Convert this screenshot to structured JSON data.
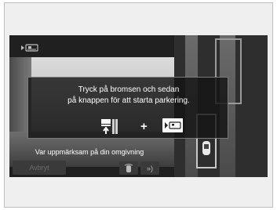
{
  "dialog": {
    "line1": "Tryck på bromsen och sedan",
    "line2": "på knappen för att starta parkering.",
    "plus": "+",
    "icons": [
      "brake-pedal-icon",
      "parking-button-icon"
    ]
  },
  "status": {
    "warning": "Var uppmärksam på din omgivning",
    "cancel_label": "Avbryt",
    "settings_label": "»)"
  },
  "icons": {
    "top_left": "parking-camera-icon",
    "bottom": [
      "car-sensor-icon",
      "sensor-waves-icon"
    ]
  },
  "colors": {
    "screen_bg": "#1e1e1e",
    "dialog_bg": "#141414",
    "text": "#ffffff"
  }
}
